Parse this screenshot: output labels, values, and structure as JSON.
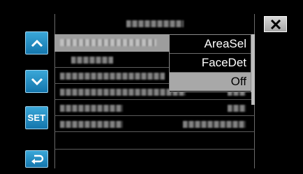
{
  "nav": {
    "up_icon": "chevron-up-icon",
    "down_icon": "chevron-down-icon",
    "set_label": "SET",
    "back_icon": "return-arrow-icon"
  },
  "close_icon": "close-x-icon",
  "menu": {
    "options": [
      "AreaSel",
      "FaceDet",
      "Off"
    ],
    "selected": "Off"
  },
  "colors": {
    "nav_button": "#1e8cc4",
    "selection": "#a8a8a8",
    "background": "#000000"
  }
}
